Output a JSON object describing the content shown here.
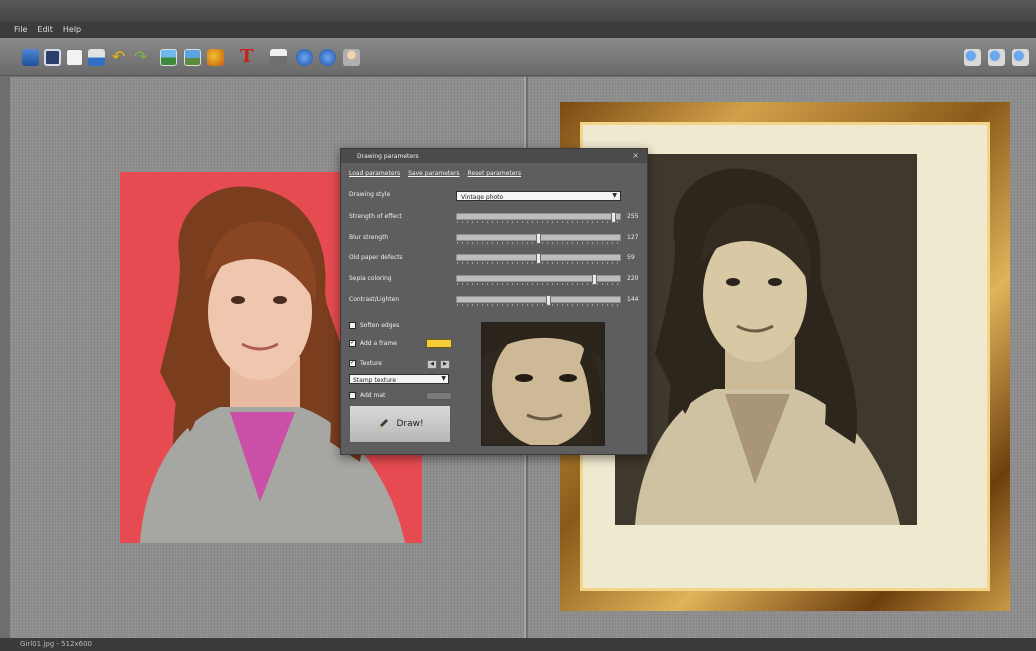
{
  "app": {
    "title": ""
  },
  "menu": {
    "items": [
      "File",
      "Edit",
      "Help"
    ]
  },
  "toolbar": {
    "icons": [
      "open-icon",
      "save-icon",
      "copy-icon",
      "paste-icon",
      "undo-icon",
      "redo-icon",
      "image-icon",
      "landscape-icon",
      "paint-icon",
      "text-icon",
      "print-icon",
      "info-icon",
      "help-icon",
      "user-icon",
      "zoom-out-icon",
      "zoom-in-icon",
      "zoom-fit-icon"
    ]
  },
  "dialog": {
    "title": "Drawing parameters",
    "links": {
      "load": "Load parameters",
      "save": "Save parameters",
      "reset": "Reset parameters"
    },
    "style_label": "Drawing style",
    "style_value": "Vintage photo",
    "sliders": [
      {
        "label": "Strength of effect",
        "value": 255,
        "fraction": 0.98
      },
      {
        "label": "Blur strength",
        "value": 127,
        "fraction": 0.5
      },
      {
        "label": "Old paper defects",
        "value": 59,
        "fraction": 0.5
      },
      {
        "label": "Sepia coloring",
        "value": 220,
        "fraction": 0.86
      },
      {
        "label": "Contrast/Lighten",
        "value": 144,
        "fraction": 0.57
      }
    ],
    "soften_edges": {
      "label": "Soften edges",
      "checked": false
    },
    "add_frame": {
      "label": "Add a frame",
      "checked": true
    },
    "texture": {
      "label": "Texture",
      "checked": true,
      "value": "Stamp texture"
    },
    "add_mat": {
      "label": "Add mat",
      "checked": false
    },
    "draw_button": "Draw!"
  },
  "status": {
    "text": "Girl01.jpg - 512x600"
  },
  "colors": {
    "frame_swatch": "#f1ce3a",
    "original_background": "#e54b50"
  }
}
